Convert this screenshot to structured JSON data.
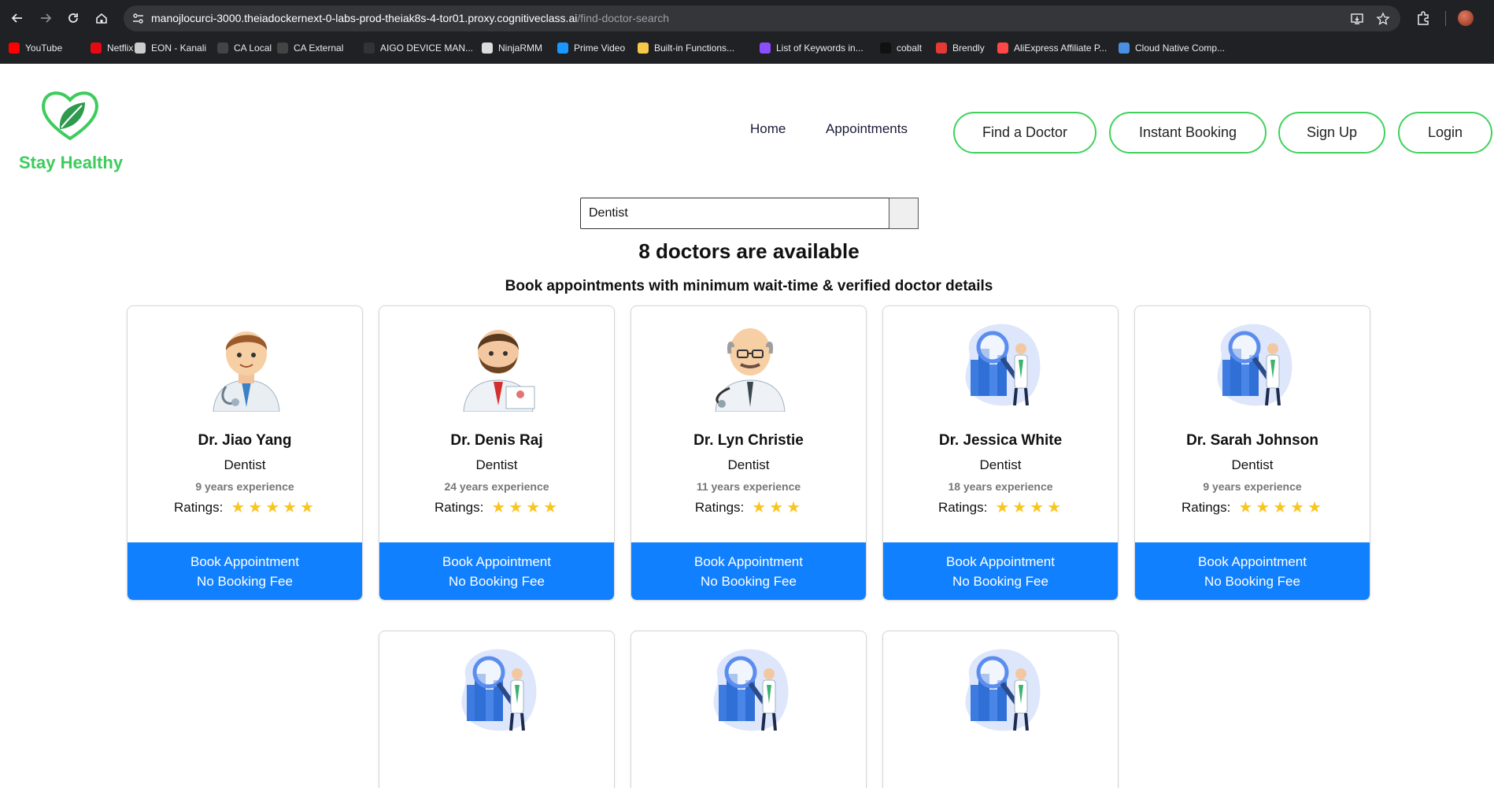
{
  "browser": {
    "url_host": "manojlocurci-3000.theiadockernext-0-labs-prod-theiak8s-4-tor01.proxy.cognitiveclass.ai",
    "url_path": "/find-doctor-search",
    "bookmarks": [
      {
        "label": "YouTube",
        "icon": "youtube-icon",
        "color": "#ff0000"
      },
      {
        "label": "Netflix",
        "icon": "netflix-icon",
        "color": "#e50914"
      },
      {
        "label": "EON - Kanali",
        "icon": "eon-icon",
        "color": "#cccccc"
      },
      {
        "label": "CA Local",
        "icon": "ca-icon",
        "color": "#444444"
      },
      {
        "label": "CA External",
        "icon": "ca-icon",
        "color": "#444444"
      },
      {
        "label": "AIGO DEVICE MAN...",
        "icon": "aigo-icon",
        "color": "#333333"
      },
      {
        "label": "NinjaRMM",
        "icon": "ninja-icon",
        "color": "#dddddd"
      },
      {
        "label": "Prime Video",
        "icon": "prime-video-icon",
        "color": "#1a98ff"
      },
      {
        "label": "Built-in Functions...",
        "icon": "python-icon",
        "color": "#f7c948"
      },
      {
        "label": "List of Keywords in...",
        "icon": "keywords-icon",
        "color": "#8a4dff"
      },
      {
        "label": "cobalt",
        "icon": "cobalt-icon",
        "color": "#111111"
      },
      {
        "label": "Brendly",
        "icon": "brendly-icon",
        "color": "#e53935"
      },
      {
        "label": "AliExpress Affiliate P...",
        "icon": "aliexpress-icon",
        "color": "#ff4747"
      },
      {
        "label": "Cloud Native Comp...",
        "icon": "cncf-icon",
        "color": "#4a90e2"
      }
    ]
  },
  "site": {
    "brand": "Stay Healthy",
    "brand_color": "#3dcc5c",
    "nav": {
      "home": "Home",
      "appointments": "Appointments"
    },
    "buttons": {
      "find_doctor": "Find a Doctor",
      "instant_booking": "Instant Booking",
      "sign_up": "Sign Up",
      "login": "Login"
    }
  },
  "search": {
    "value": "Dentist"
  },
  "results": {
    "heading": "8 doctors are available",
    "subheading": "Book appointments with minimum wait-time & verified doctor details"
  },
  "book_button": {
    "line1": "Book Appointment",
    "line2": "No Booking Fee"
  },
  "ratings_label": "Ratings:",
  "doctors": [
    {
      "name": "Dr. Jiao Yang",
      "speciality": "Dentist",
      "experience": "9 years experience",
      "rating": 5,
      "avatar": "young-doctor-avatar"
    },
    {
      "name": "Dr. Denis Raj",
      "speciality": "Dentist",
      "experience": "24 years experience",
      "rating": 4,
      "avatar": "bearded-doctor-avatar"
    },
    {
      "name": "Dr. Lyn Christie",
      "speciality": "Dentist",
      "experience": "11 years experience",
      "rating": 3,
      "avatar": "senior-doctor-avatar"
    },
    {
      "name": "Dr. Jessica White",
      "speciality": "Dentist",
      "experience": "18 years experience",
      "rating": 4,
      "avatar": "doctor-search-illustration"
    },
    {
      "name": "Dr. Sarah Johnson",
      "speciality": "Dentist",
      "experience": "9 years experience",
      "rating": 5,
      "avatar": "doctor-search-illustration"
    },
    {
      "avatar": "doctor-search-illustration"
    },
    {
      "avatar": "doctor-search-illustration"
    },
    {
      "avatar": "doctor-search-illustration"
    }
  ]
}
